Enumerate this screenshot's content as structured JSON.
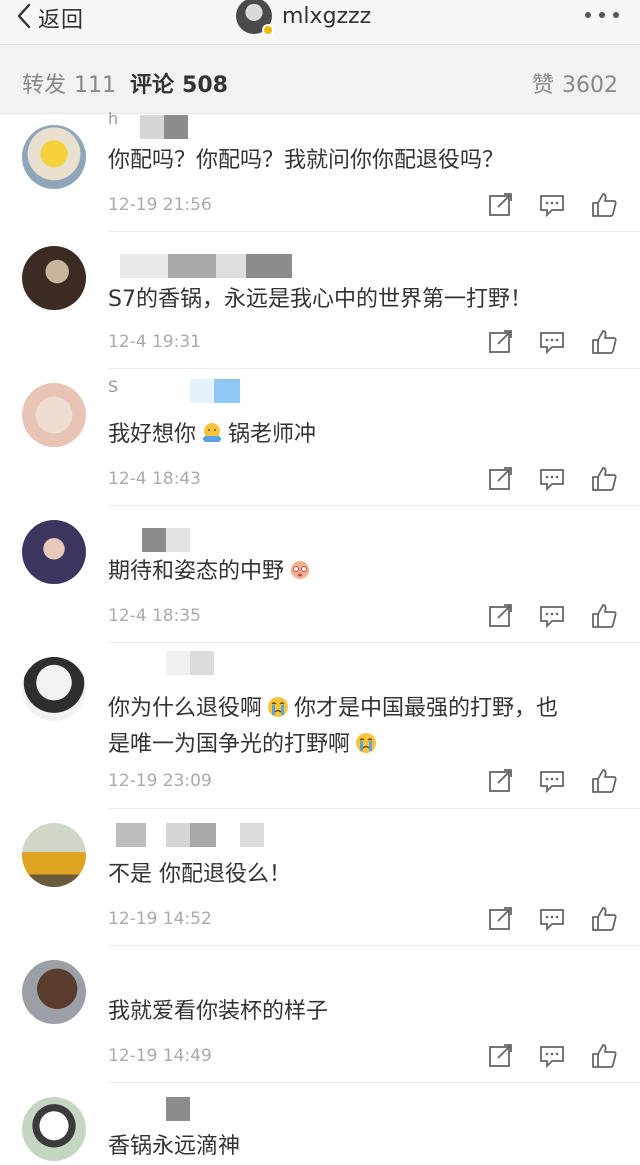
{
  "header": {
    "back_label": "返回",
    "username": "mlxgzzz",
    "avatar_icon": "user-avatar",
    "more_icon": "more-dots-icon"
  },
  "stats": {
    "repost_label": "转发",
    "repost_count": "111",
    "comment_label": "评论",
    "comment_count": "508",
    "like_label": "赞",
    "like_count": "3602"
  },
  "comments": [
    {
      "name_fragment": "h",
      "text": "你配吗？你配吗？我就问你你配退役吗？",
      "time": "12-19 21:56"
    },
    {
      "name_fragment": "",
      "text": "S7的香锅，永远是我心中的世界第一打野！",
      "time": "12-4 19:31"
    },
    {
      "name_fragment": "S",
      "text": "我好想你 🤗 锅老师冲",
      "text_before_emoji": "我好想你",
      "text_after_emoji": "锅老师冲",
      "time": "12-4 18:43"
    },
    {
      "name_fragment": "",
      "text": "期待和姿态的中野 😵",
      "text_before_emoji": "期待和姿态的中野",
      "time": "12-4 18:35"
    },
    {
      "name_fragment": "",
      "line1_before": "你为什么退役啊",
      "line1_after": "你才是中国最强的打野，也",
      "line2_before": "是唯一为国争光的打野啊",
      "time": "12-19 23:09"
    },
    {
      "name_fragment": "",
      "text": "不是  你配退役么！",
      "time": "12-19 14:52"
    },
    {
      "name_fragment": "",
      "text": "我就爱看你装杯的样子",
      "time": "12-19 14:49"
    },
    {
      "name_fragment": "",
      "text": "香锅永远滴神",
      "time": ""
    }
  ],
  "colors": {
    "text": "#333333",
    "muted": "#aaaaaa",
    "stats_bg": "#f2f2f2",
    "nav_bg": "#f7f7f7"
  }
}
